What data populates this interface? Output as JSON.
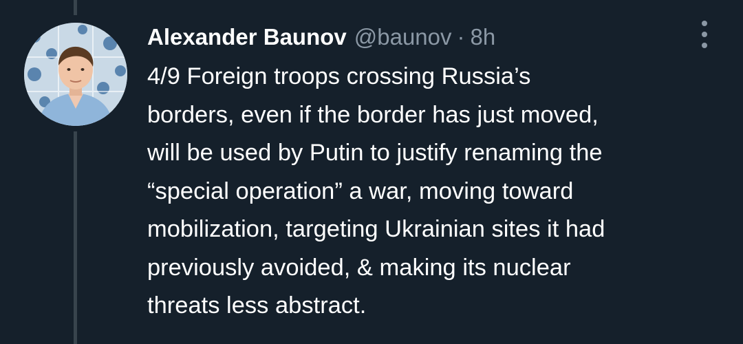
{
  "tweet": {
    "author": {
      "display_name": "Alexander Baunov",
      "handle": "@baunov",
      "avatar_icon": "user-avatar"
    },
    "separator": "·",
    "time": "8h",
    "text": "4/9 Foreign troops crossing Russia’s\nborders, even if the border has just moved,\nwill be used by Putin to justify renaming the\n“special operation” a war, moving toward\nmobilization, targeting Ukrainian sites it had\npreviously avoided, & making its nuclear\nthreats less abstract.",
    "more_icon": "more-options-icon"
  },
  "colors": {
    "background": "#15202b",
    "thread_line": "#38444d",
    "primary_text": "#ffffff",
    "secondary_text": "#8b98a5"
  }
}
